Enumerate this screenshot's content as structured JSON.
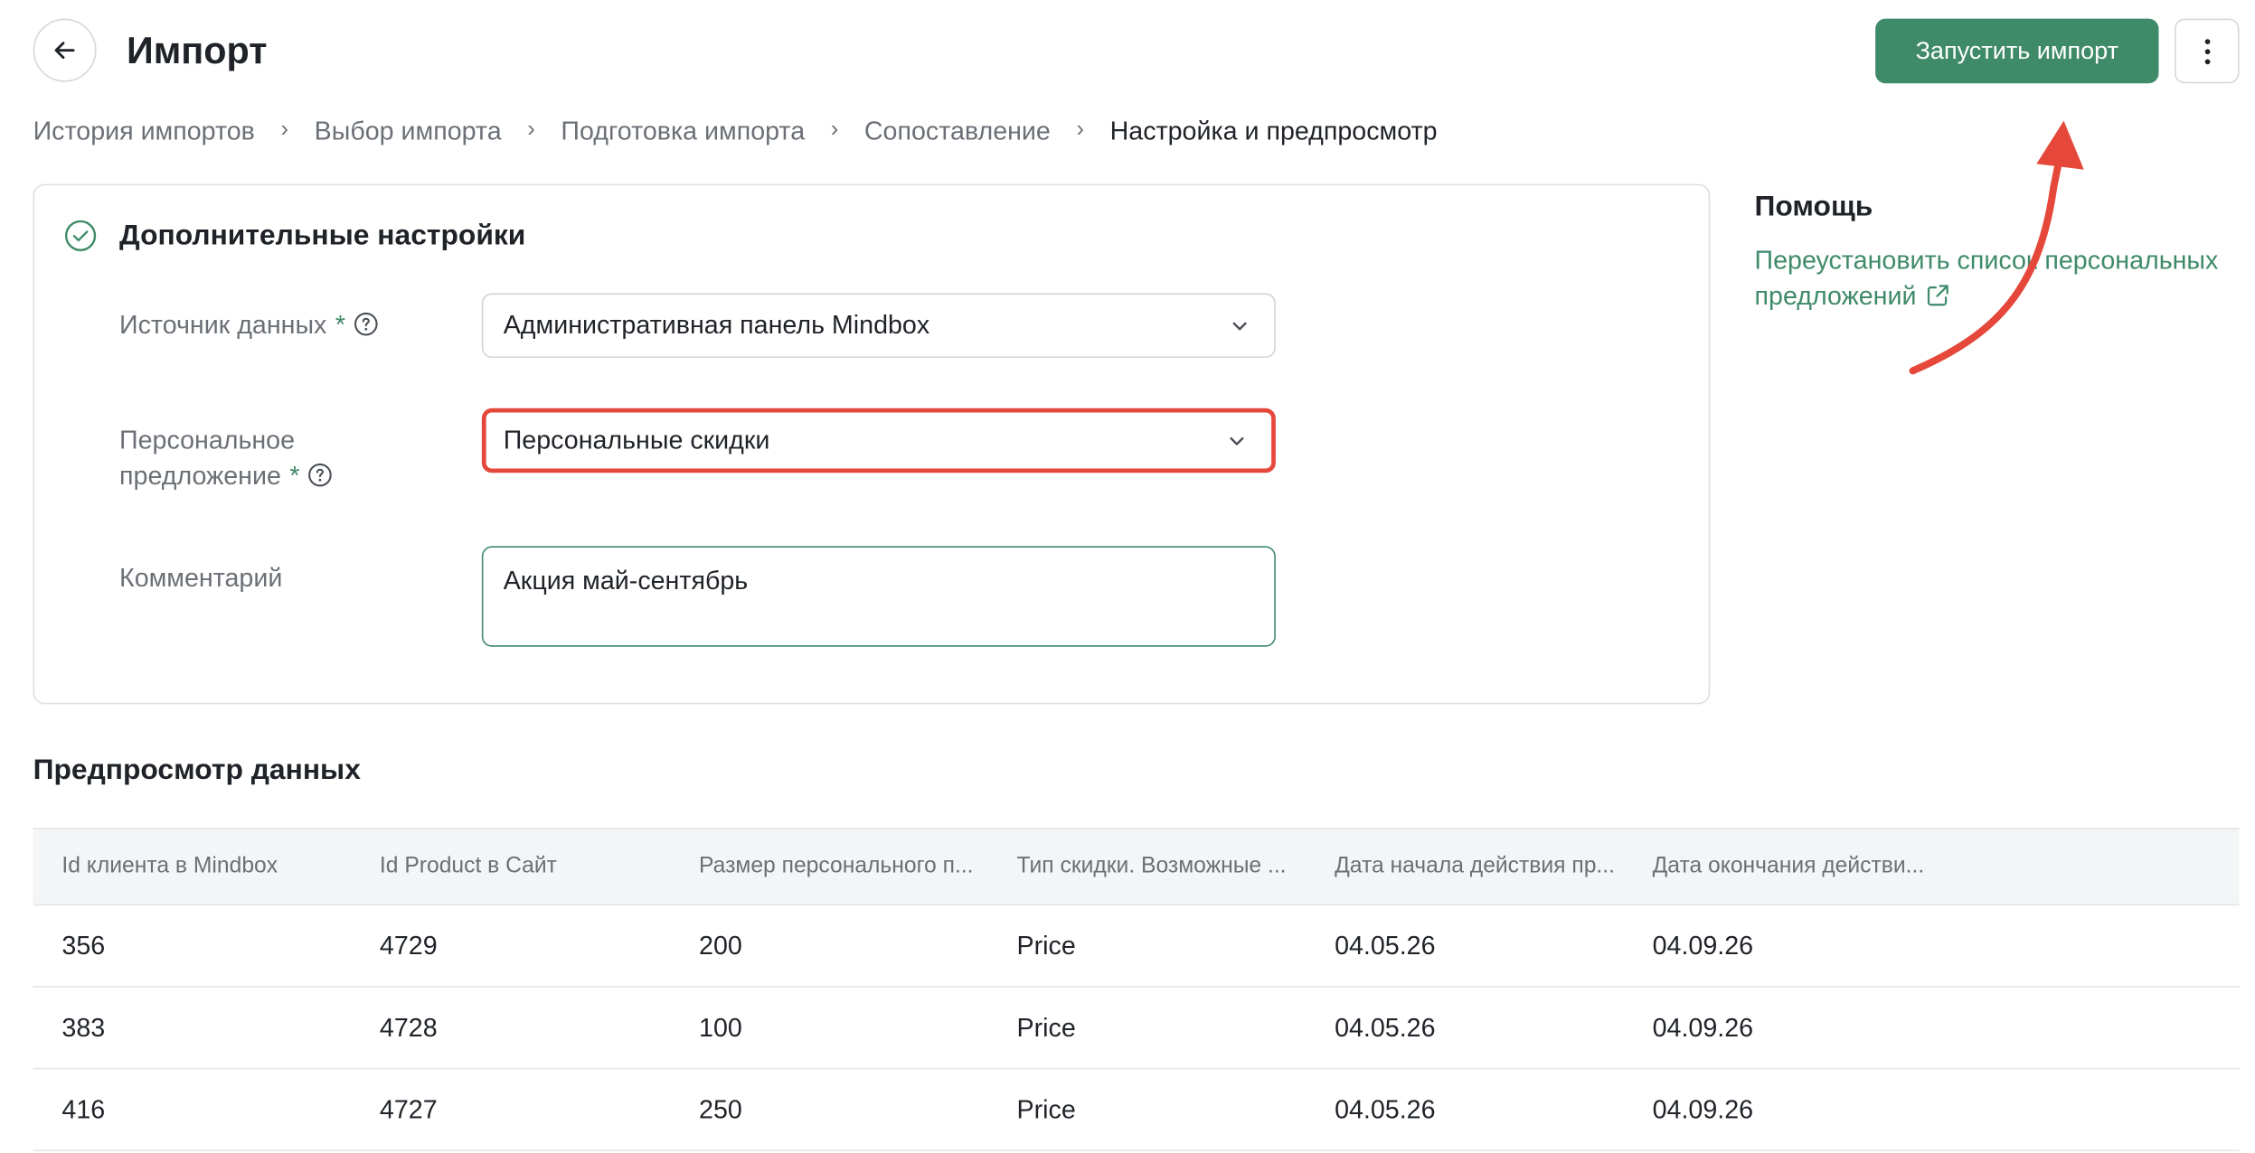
{
  "header": {
    "title": "Импорт",
    "run_button": "Запустить импорт"
  },
  "breadcrumb": [
    "История импортов",
    "Выбор импорта",
    "Подготовка импорта",
    "Сопоставление",
    "Настройка и предпросмотр"
  ],
  "settings": {
    "title": "Дополнительные настройки",
    "source": {
      "label": "Источник данных",
      "required_mark": "*",
      "value": "Административная панель Mindbox"
    },
    "offer": {
      "label_line1": "Персональное",
      "label_line2": "предложение",
      "required_mark": "*",
      "value": "Персональные скидки"
    },
    "comment": {
      "label": "Комментарий",
      "value": "Акция май-сентябрь"
    }
  },
  "help": {
    "title": "Помощь",
    "link": "Переустановить список персональных предложений"
  },
  "preview": {
    "title": "Предпросмотр данных",
    "columns": [
      "Id клиента в Mindbox",
      "Id Product в Сайт",
      "Размер персонального п...",
      "Тип скидки. Возможные ...",
      "Дата начала действия пр...",
      "Дата окончания действи..."
    ],
    "rows": [
      [
        "356",
        "4729",
        "200",
        "Price",
        "04.05.26",
        "04.09.26"
      ],
      [
        "383",
        "4728",
        "100",
        "Price",
        "04.05.26",
        "04.09.26"
      ],
      [
        "416",
        "4727",
        "250",
        "Price",
        "04.05.26",
        "04.09.26"
      ]
    ]
  },
  "colors": {
    "accent": "#3f8a69",
    "highlight": "#e5483a"
  },
  "icons": {
    "back": "arrow-left-icon",
    "more": "kebab-menu-icon",
    "check": "check-circle-icon",
    "help": "question-circle-icon",
    "chevron": "chevron-down-icon",
    "external": "external-link-icon"
  }
}
